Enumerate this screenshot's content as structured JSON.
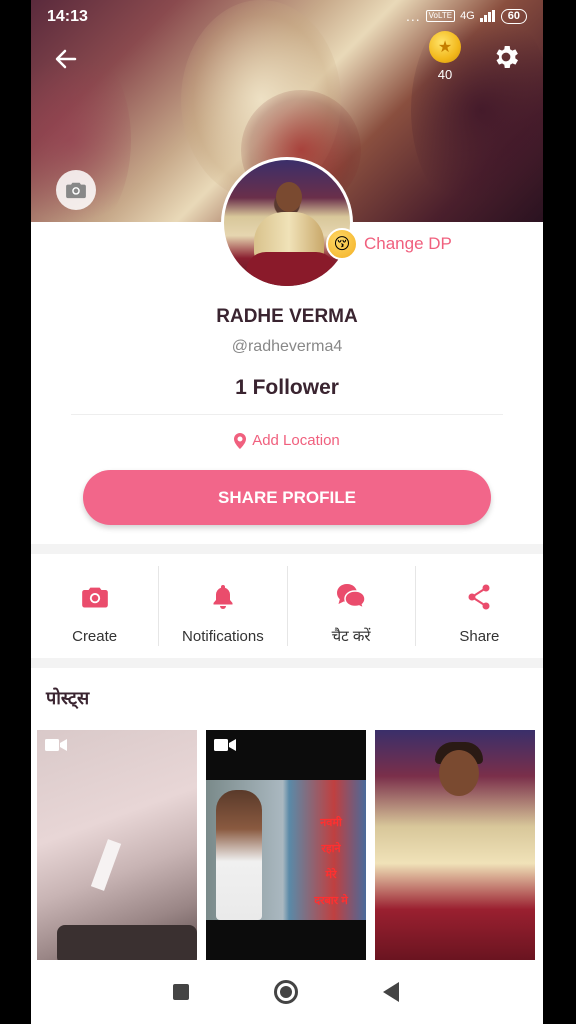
{
  "status_bar": {
    "time": "14:13",
    "dots": "...",
    "volte": "VoLTE",
    "network": "4G",
    "battery": "60"
  },
  "header": {
    "coin_count": "40"
  },
  "profile": {
    "change_dp_label": "Change DP",
    "name": "RADHE VERMA",
    "handle": "@radheverma4",
    "followers": "1 Follower",
    "location_label": "Add Location",
    "share_button": "SHARE PROFILE"
  },
  "actions": [
    {
      "label": "Create",
      "icon": "camera-icon"
    },
    {
      "label": "Notifications",
      "icon": "bell-icon"
    },
    {
      "label": "चैट करें",
      "icon": "chat-bubbles-icon"
    },
    {
      "label": "Share",
      "icon": "share-icon"
    }
  ],
  "posts": {
    "title": "पोस्ट्स",
    "thumb2_text": [
      "नवमी",
      "रहाने",
      "मेरे",
      "दरबार मे"
    ]
  },
  "colors": {
    "accent": "#f2668a",
    "accent_text": "#f0607e",
    "title_text": "#3a2430"
  }
}
